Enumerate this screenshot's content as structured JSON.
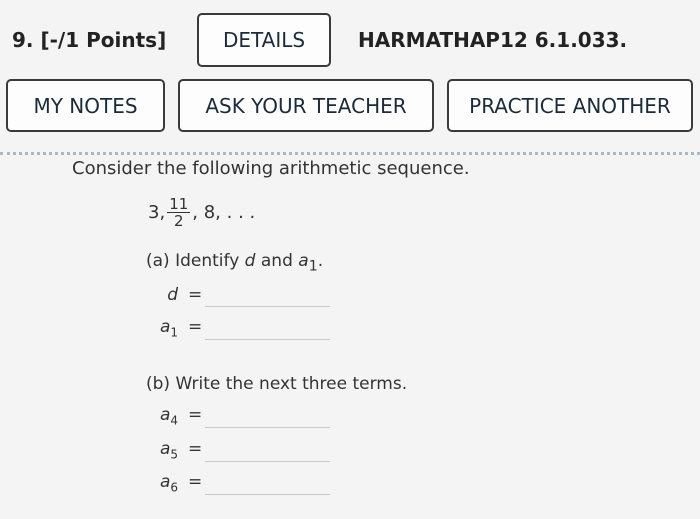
{
  "header": {
    "question_number": "9.",
    "points": "[-/1 Points]",
    "details_label": "DETAILS",
    "code": "HARMATHAP12 6.1.033."
  },
  "actions": {
    "my_notes": "MY NOTES",
    "ask_teacher": "ASK YOUR TEACHER",
    "practice_another": "PRACTICE ANOTHER"
  },
  "question": {
    "statement": "Consider the following arithmetic sequence.",
    "sequence": {
      "first": "3,",
      "frac_num": "11",
      "frac_den": "2",
      "rest": ", 8, . . ."
    },
    "part_a": {
      "prefix": "(a) Identify",
      "d": "d",
      "and": "and",
      "a": "a",
      "sub": "1",
      "suffix": "."
    },
    "part_b": "(b) Write the next three terms.",
    "answers": [
      {
        "var": "d",
        "sub": "",
        "value": ""
      },
      {
        "var": "a",
        "sub": "1",
        "value": ""
      },
      {
        "var": "a",
        "sub": "4",
        "value": ""
      },
      {
        "var": "a",
        "sub": "5",
        "value": ""
      },
      {
        "var": "a",
        "sub": "6",
        "value": ""
      }
    ],
    "equals": "="
  },
  "colors": {
    "button_border": "#3a3a3a",
    "divider": "#a8b8c8",
    "background": "#f4f4f4"
  }
}
